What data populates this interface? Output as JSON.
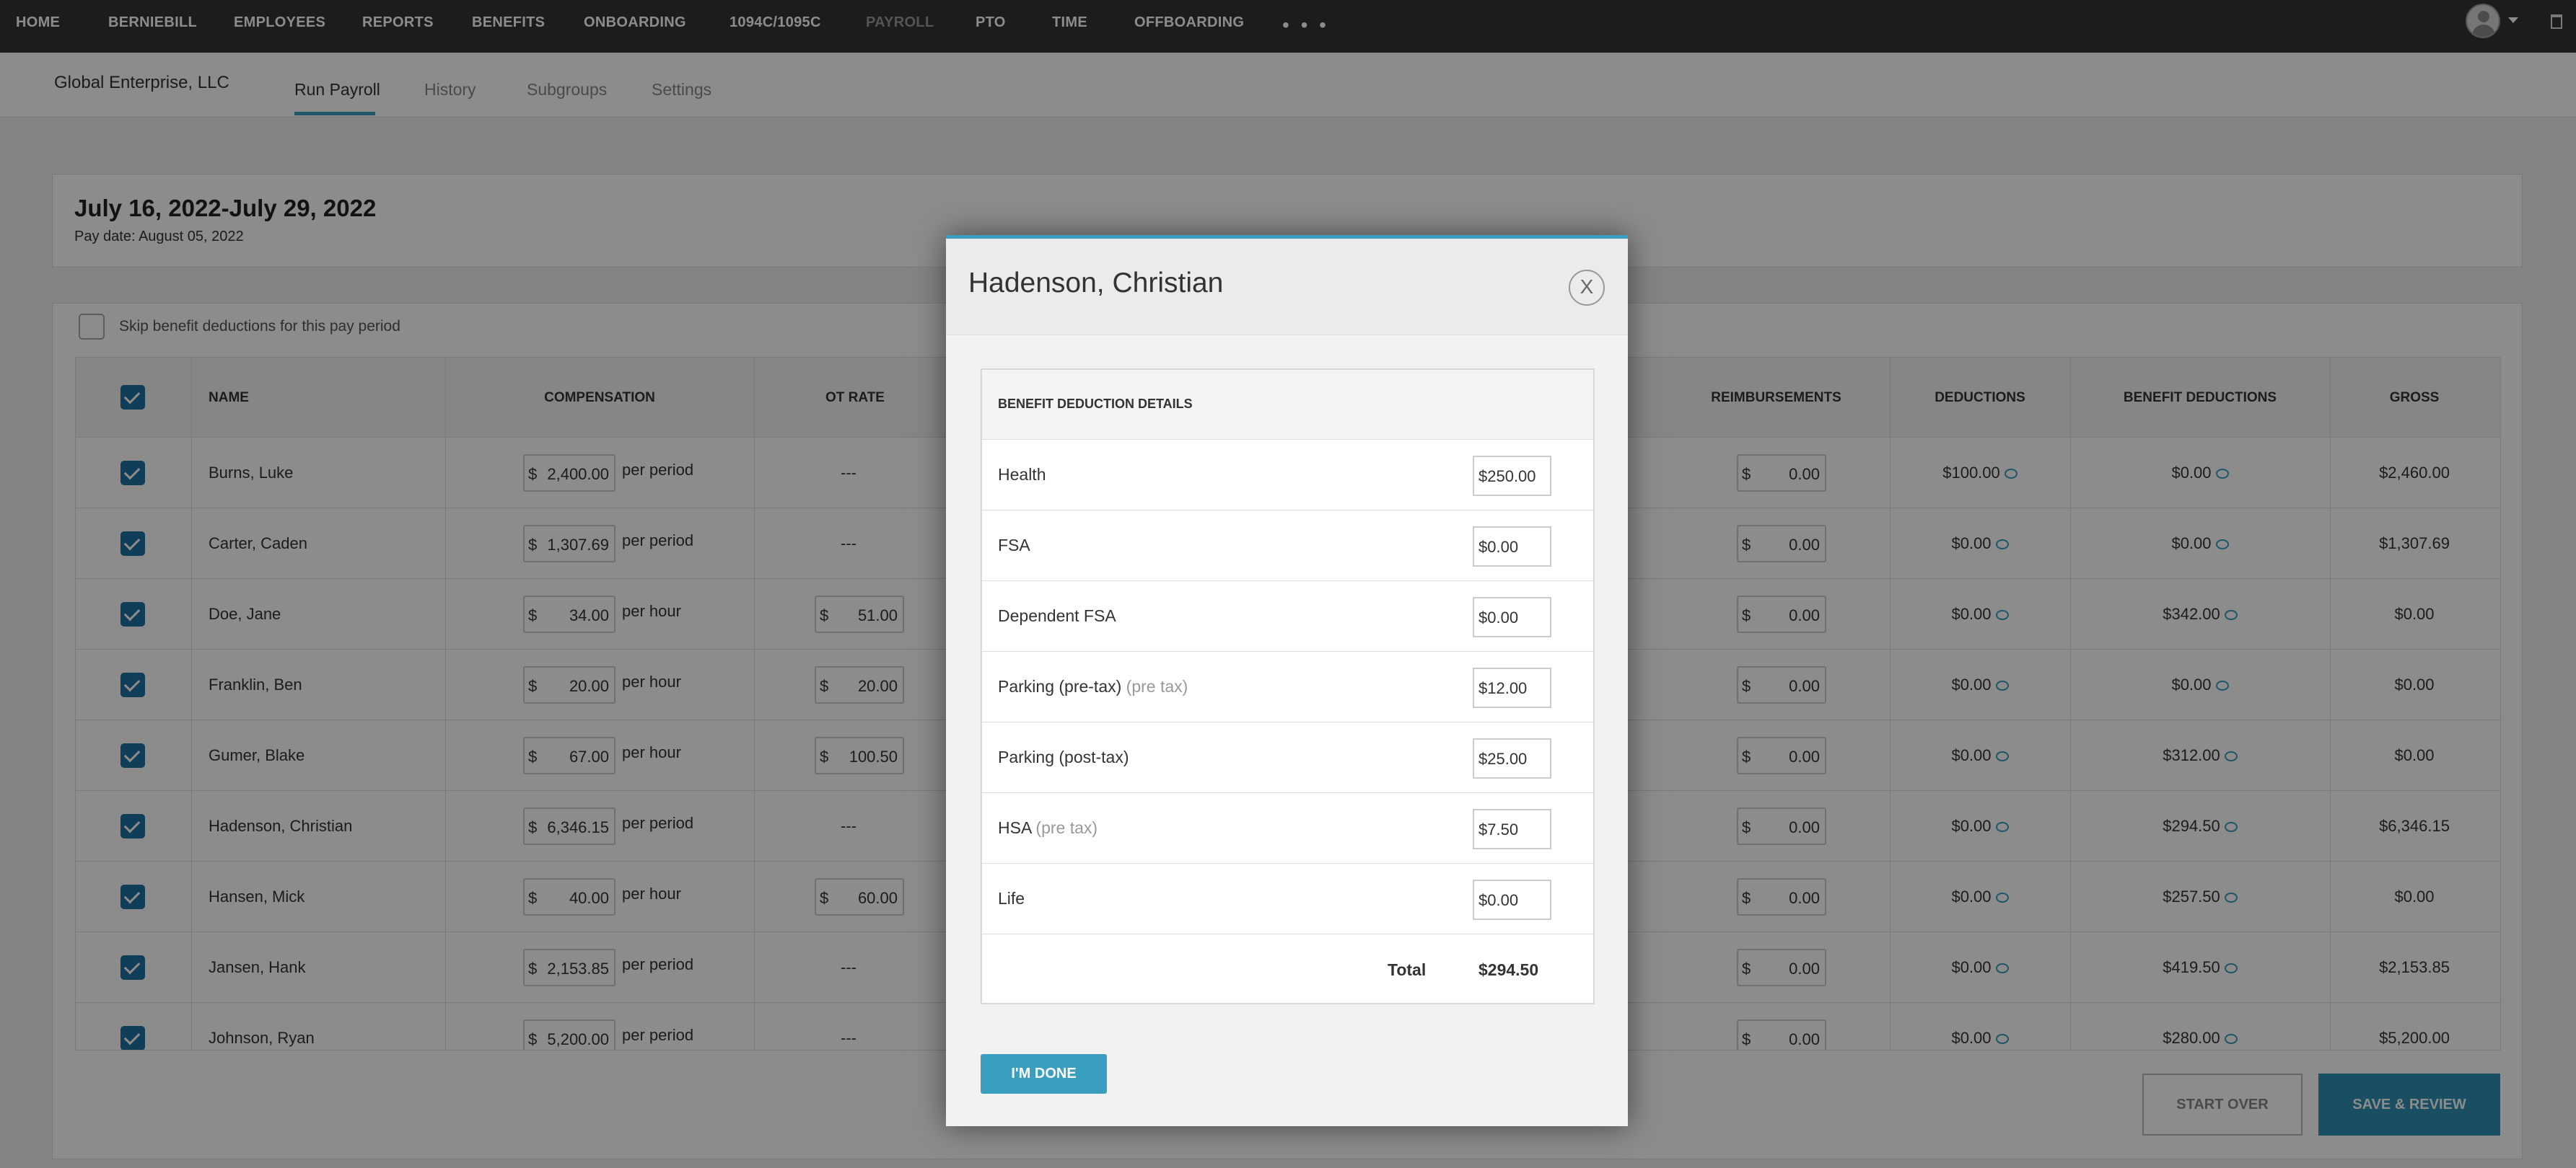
{
  "nav": {
    "items": [
      "HOME",
      "BERNIEBILL",
      "EMPLOYEES",
      "REPORTS",
      "BENEFITS",
      "ONBOARDING",
      "1094C/1095C",
      "PAYROLL",
      "PTO",
      "TIME",
      "OFFBOARDING"
    ],
    "more": "• • •"
  },
  "subheader": {
    "company": "Global Enterprise, LLC",
    "tabs": [
      "Run Payroll",
      "History",
      "Subgroups",
      "Settings"
    ]
  },
  "period": {
    "title": "July 16, 2022-July 29, 2022",
    "pay_date": "Pay date: August 05, 2022"
  },
  "skip_label": "Skip benefit deductions for this pay period",
  "table": {
    "headers": {
      "name": "NAME",
      "compensation": "COMPENSATION",
      "ot_rate": "OT RATE",
      "reimbursements": "REIMBURSEMENTS",
      "deductions": "DEDUCTIONS",
      "benefit_deductions": "BENEFIT DEDUCTIONS",
      "gross": "GROSS"
    },
    "rows": [
      {
        "name": "Burns, Luke",
        "comp": "2,400.00",
        "unit": "per period",
        "ot": "---",
        "reimb": "0.00",
        "ded": "$100.00",
        "ben": "$0.00",
        "gross": "$2,460.00"
      },
      {
        "name": "Carter, Caden",
        "comp": "1,307.69",
        "unit": "per period",
        "ot": "---",
        "reimb": "0.00",
        "ded": "$0.00",
        "ben": "$0.00",
        "gross": "$1,307.69"
      },
      {
        "name": "Doe, Jane",
        "comp": "34.00",
        "unit": "per hour",
        "ot": "51.00",
        "reimb": "0.00",
        "ded": "$0.00",
        "ben": "$342.00",
        "gross": "$0.00"
      },
      {
        "name": "Franklin, Ben",
        "comp": "20.00",
        "unit": "per hour",
        "ot": "20.00",
        "reimb": "0.00",
        "ded": "$0.00",
        "ben": "$0.00",
        "gross": "$0.00"
      },
      {
        "name": "Gumer, Blake",
        "comp": "67.00",
        "unit": "per hour",
        "ot": "100.50",
        "reimb": "0.00",
        "ded": "$0.00",
        "ben": "$312.00",
        "gross": "$0.00"
      },
      {
        "name": "Hadenson, Christian",
        "comp": "6,346.15",
        "unit": "per period",
        "ot": "---",
        "reimb": "0.00",
        "ded": "$0.00",
        "ben": "$294.50",
        "gross": "$6,346.15"
      },
      {
        "name": "Hansen, Mick",
        "comp": "40.00",
        "unit": "per hour",
        "ot": "60.00",
        "reimb": "0.00",
        "ded": "$0.00",
        "ben": "$257.50",
        "gross": "$0.00"
      },
      {
        "name": "Jansen, Hank",
        "comp": "2,153.85",
        "unit": "per period",
        "ot": "---",
        "reimb": "0.00",
        "ded": "$0.00",
        "ben": "$419.50",
        "gross": "$2,153.85"
      },
      {
        "name": "Johnson, Ryan",
        "comp": "5,200.00",
        "unit": "per period",
        "ot": "---",
        "reimb": "0.00",
        "ded": "$0.00",
        "ben": "$280.00",
        "gross": "$5,200.00"
      }
    ],
    "currency": "$"
  },
  "buttons": {
    "start_over": "START OVER",
    "save_review": "SAVE & REVIEW"
  },
  "modal": {
    "title": "Hadenson, Christian",
    "close": "X",
    "table_header": "BENEFIT DEDUCTION DETAILS",
    "pretax_note": "(pre tax)",
    "items": [
      {
        "name": "Health",
        "value": "$250.00"
      },
      {
        "name": "FSA",
        "value": "$0.00"
      },
      {
        "name": "Dependent FSA",
        "value": "$0.00"
      },
      {
        "name": "Parking (pre-tax)",
        "pretax": "(pre tax)",
        "value": "$12.00"
      },
      {
        "name": "Parking (post-tax)",
        "value": "$25.00"
      },
      {
        "name": "HSA",
        "pretax": "(pre tax)",
        "value": "$7.50"
      },
      {
        "name": "Life",
        "value": "$0.00"
      }
    ],
    "total_label": "Total",
    "total_value": "$294.50",
    "done": "I'M DONE"
  },
  "colors": {
    "accent": "#3a9fbf",
    "checkbox": "#1e6fa0",
    "nav_bg": "#343434"
  }
}
